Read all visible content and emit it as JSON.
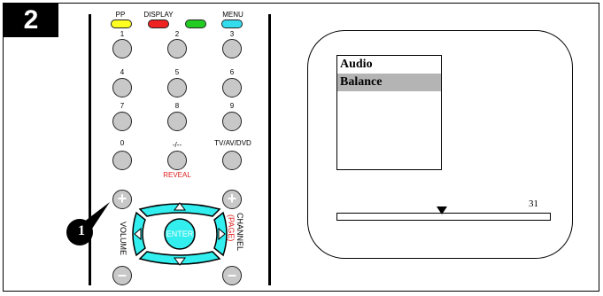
{
  "step": {
    "number": "2"
  },
  "callout": {
    "number": "1"
  },
  "remote": {
    "top_buttons": [
      {
        "label": "PP",
        "color": "#ffff22"
      },
      {
        "label": "DISPLAY",
        "color": "#ee2222"
      },
      {
        "label": "",
        "color": "#22cc22"
      },
      {
        "label": "MENU",
        "color": "#33ddee"
      }
    ],
    "number_keys": [
      {
        "label": "1"
      },
      {
        "label": "2"
      },
      {
        "label": "3"
      },
      {
        "label": "4"
      },
      {
        "label": "5"
      },
      {
        "label": "6"
      },
      {
        "label": "7"
      },
      {
        "label": "8"
      },
      {
        "label": "9"
      },
      {
        "label": "0"
      },
      {
        "label": "-/--"
      },
      {
        "label": "TV/AV/DVD"
      }
    ],
    "reveal_label": "REVEAL",
    "volume_label": "VOLUME",
    "channel_label": "CHANNEL",
    "page_label": "(PAGE)",
    "plus_glyph": "+",
    "minus_glyph": "–",
    "enter_label": "ENTER",
    "dpad_color": "#33eeee"
  },
  "screen": {
    "menu_items": [
      {
        "label": "Audio"
      },
      {
        "label": "Balance"
      }
    ],
    "balance_value": "31",
    "balance_level_fraction": 0.49
  }
}
